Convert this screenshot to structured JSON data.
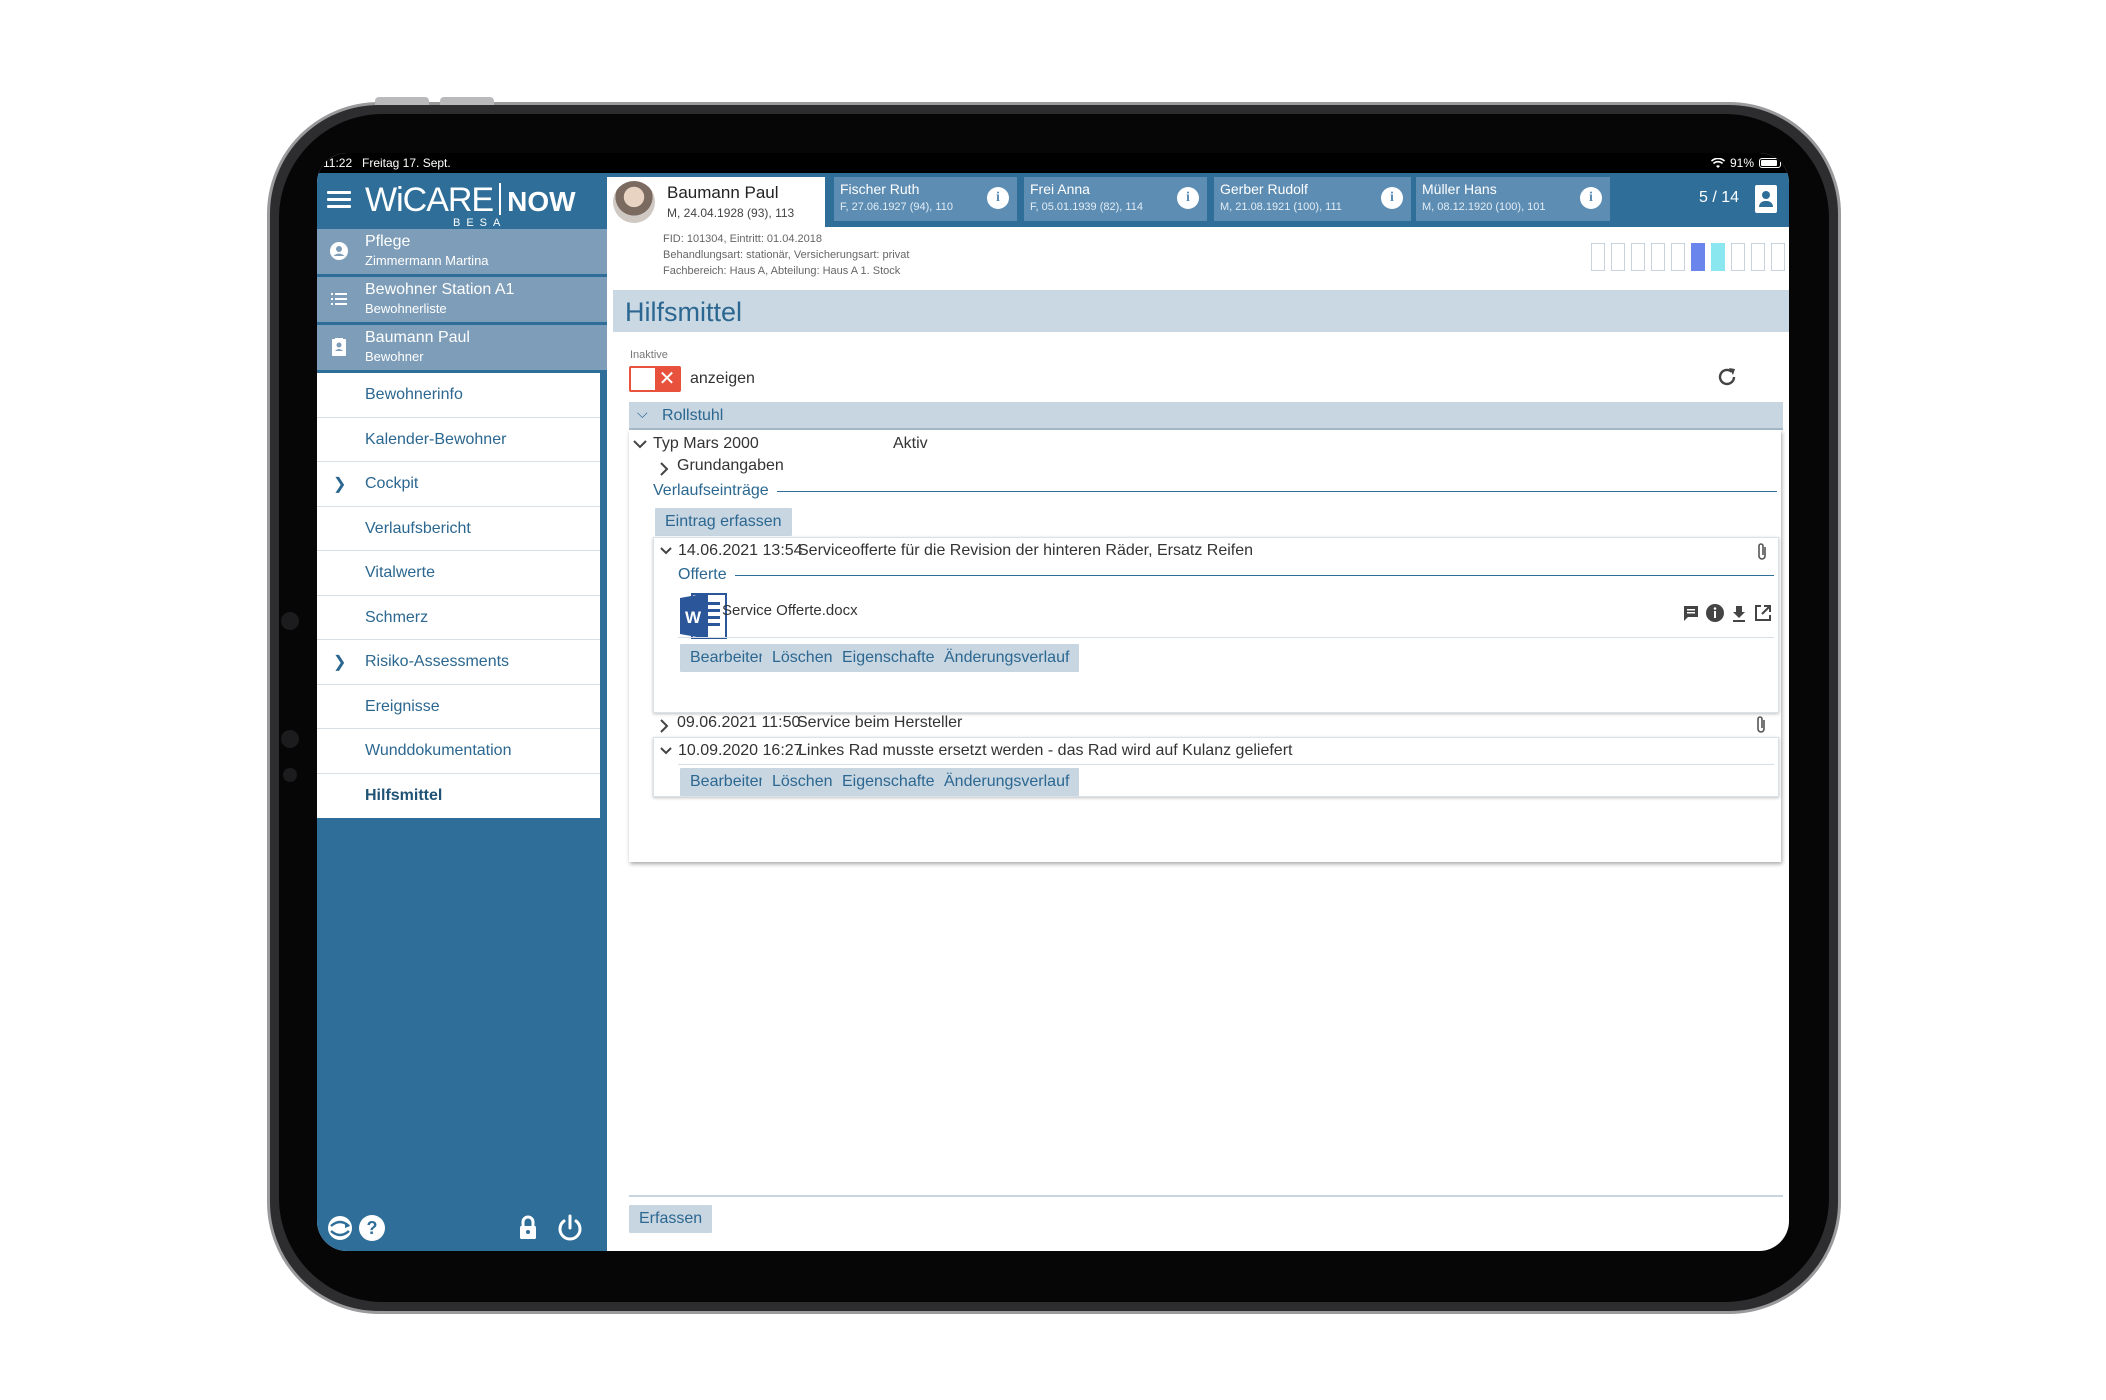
{
  "status_bar": {
    "time": "11:22",
    "date": "Freitag 17. Sept.",
    "battery": "91%"
  },
  "app": {
    "logo_main": "WiCARE",
    "logo_now": "NOW",
    "logo_sub": "BESA"
  },
  "sidebar": {
    "context": [
      {
        "title": "Pflege",
        "subtitle": "Zimmermann Martina",
        "icon": "person-circle-icon"
      },
      {
        "title": "Bewohner Station A1",
        "subtitle": "Bewohnerliste",
        "icon": "list-icon"
      },
      {
        "title": "Baumann Paul",
        "subtitle": "Bewohner",
        "icon": "contact-card-icon"
      }
    ],
    "menu": [
      {
        "label": "Bewohnerinfo",
        "expandable": false
      },
      {
        "label": "Kalender-Bewohner",
        "expandable": false
      },
      {
        "label": "Cockpit",
        "expandable": true
      },
      {
        "label": "Verlaufsbericht",
        "expandable": false
      },
      {
        "label": "Vitalwerte",
        "expandable": false
      },
      {
        "label": "Schmerz",
        "expandable": false
      },
      {
        "label": "Risiko-Assessments",
        "expandable": true
      },
      {
        "label": "Ereignisse",
        "expandable": false
      },
      {
        "label": "Wunddokumentation",
        "expandable": false
      },
      {
        "label": "Hilfsmittel",
        "expandable": false,
        "active": true
      }
    ]
  },
  "patients": {
    "current": {
      "name": "Baumann Paul",
      "details": "M, 24.04.1928 (93), 113"
    },
    "tabs": [
      {
        "name": "Fischer Ruth",
        "details": "F, 27.06.1927 (94), 110"
      },
      {
        "name": "Frei Anna",
        "details": "F, 05.01.1939 (82), 114"
      },
      {
        "name": "Gerber Rudolf",
        "details": "M, 21.08.1921 (100), 111"
      },
      {
        "name": "Müller Hans",
        "details": "M, 08.12.1920 (100), 101"
      }
    ],
    "counter": "5 / 14",
    "meta": {
      "line1": "FID: 101304, Eintritt: 01.04.2018",
      "line2": "Behandlungsart: stationär, Versicherungsart: privat",
      "line3": "Fachbereich: Haus A, Abteilung: Haus A 1. Stock"
    }
  },
  "page": {
    "title": "Hilfsmittel",
    "inactive_label": "Inaktive",
    "show_label": "anzeigen",
    "group": "Rollstuhl",
    "item": {
      "name": "Typ Mars 2000",
      "status": "Aktiv"
    },
    "grundangaben": "Grundangaben",
    "verlauf_label": "Verlaufseinträge",
    "add_entry": "Eintrag erfassen",
    "entries": [
      {
        "datetime": "14.06.2021 13:54",
        "text": "Serviceofferte für die Revision der hinteren Räder, Ersatz Reifen"
      },
      {
        "datetime": "09.06.2021 11:50",
        "text": "Service beim Hersteller"
      },
      {
        "datetime": "10.09.2020 16:27",
        "text": "Linkes Rad musste ersetzt werden - das Rad wird auf Kulanz geliefert"
      }
    ],
    "offerte_label": "Offerte",
    "document": {
      "filename": "Service Offerte.docx",
      "icon": "word-document-icon"
    },
    "actions": {
      "edit": "Bearbeiten",
      "delete": "Löschen",
      "properties": "Eigenschaften",
      "history": "Änderungsverlauf"
    },
    "create": "Erfassen"
  },
  "colors": {
    "primary": "#2e6e98",
    "sidebar_ctx": "#7e9db8",
    "header_bg": "#cad8e3",
    "toggle_red": "#e8523c"
  }
}
